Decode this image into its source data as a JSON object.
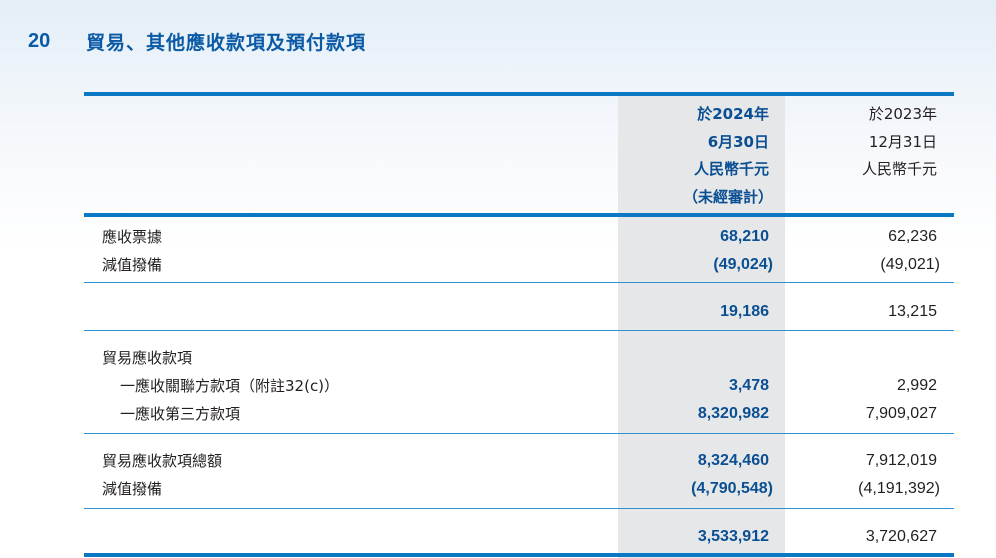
{
  "note": {
    "number": "20",
    "title": "貿易、其他應收款項及預付款項"
  },
  "header": {
    "current": {
      "line1": "於2024年",
      "line2": "6月30日",
      "line3": "人民幣千元",
      "line4": "（未經審計）"
    },
    "previous": {
      "line1": "於2023年",
      "line2": "12月31日",
      "line3": "人民幣千元"
    }
  },
  "rows": [
    {
      "label": "應收票據",
      "current": "68,210",
      "previous": "62,236"
    },
    {
      "label": "減值撥備",
      "current": "(49,024)",
      "previous": "(49,021)"
    },
    {
      "label": "",
      "current": "19,186",
      "previous": "13,215"
    },
    {
      "label": "貿易應收款項",
      "current": "",
      "previous": ""
    },
    {
      "label": "一應收關聯方款項（附註32(c)）",
      "current": "3,478",
      "previous": "2,992"
    },
    {
      "label": "一應收第三方款項",
      "current": "8,320,982",
      "previous": "7,909,027"
    },
    {
      "label": "貿易應收款項總額",
      "current": "8,324,460",
      "previous": "7,912,019"
    },
    {
      "label": "減值撥備",
      "current": "(4,790,548)",
      "previous": "(4,191,392)"
    },
    {
      "label": "",
      "current": "3,533,912",
      "previous": "3,720,627"
    }
  ]
}
